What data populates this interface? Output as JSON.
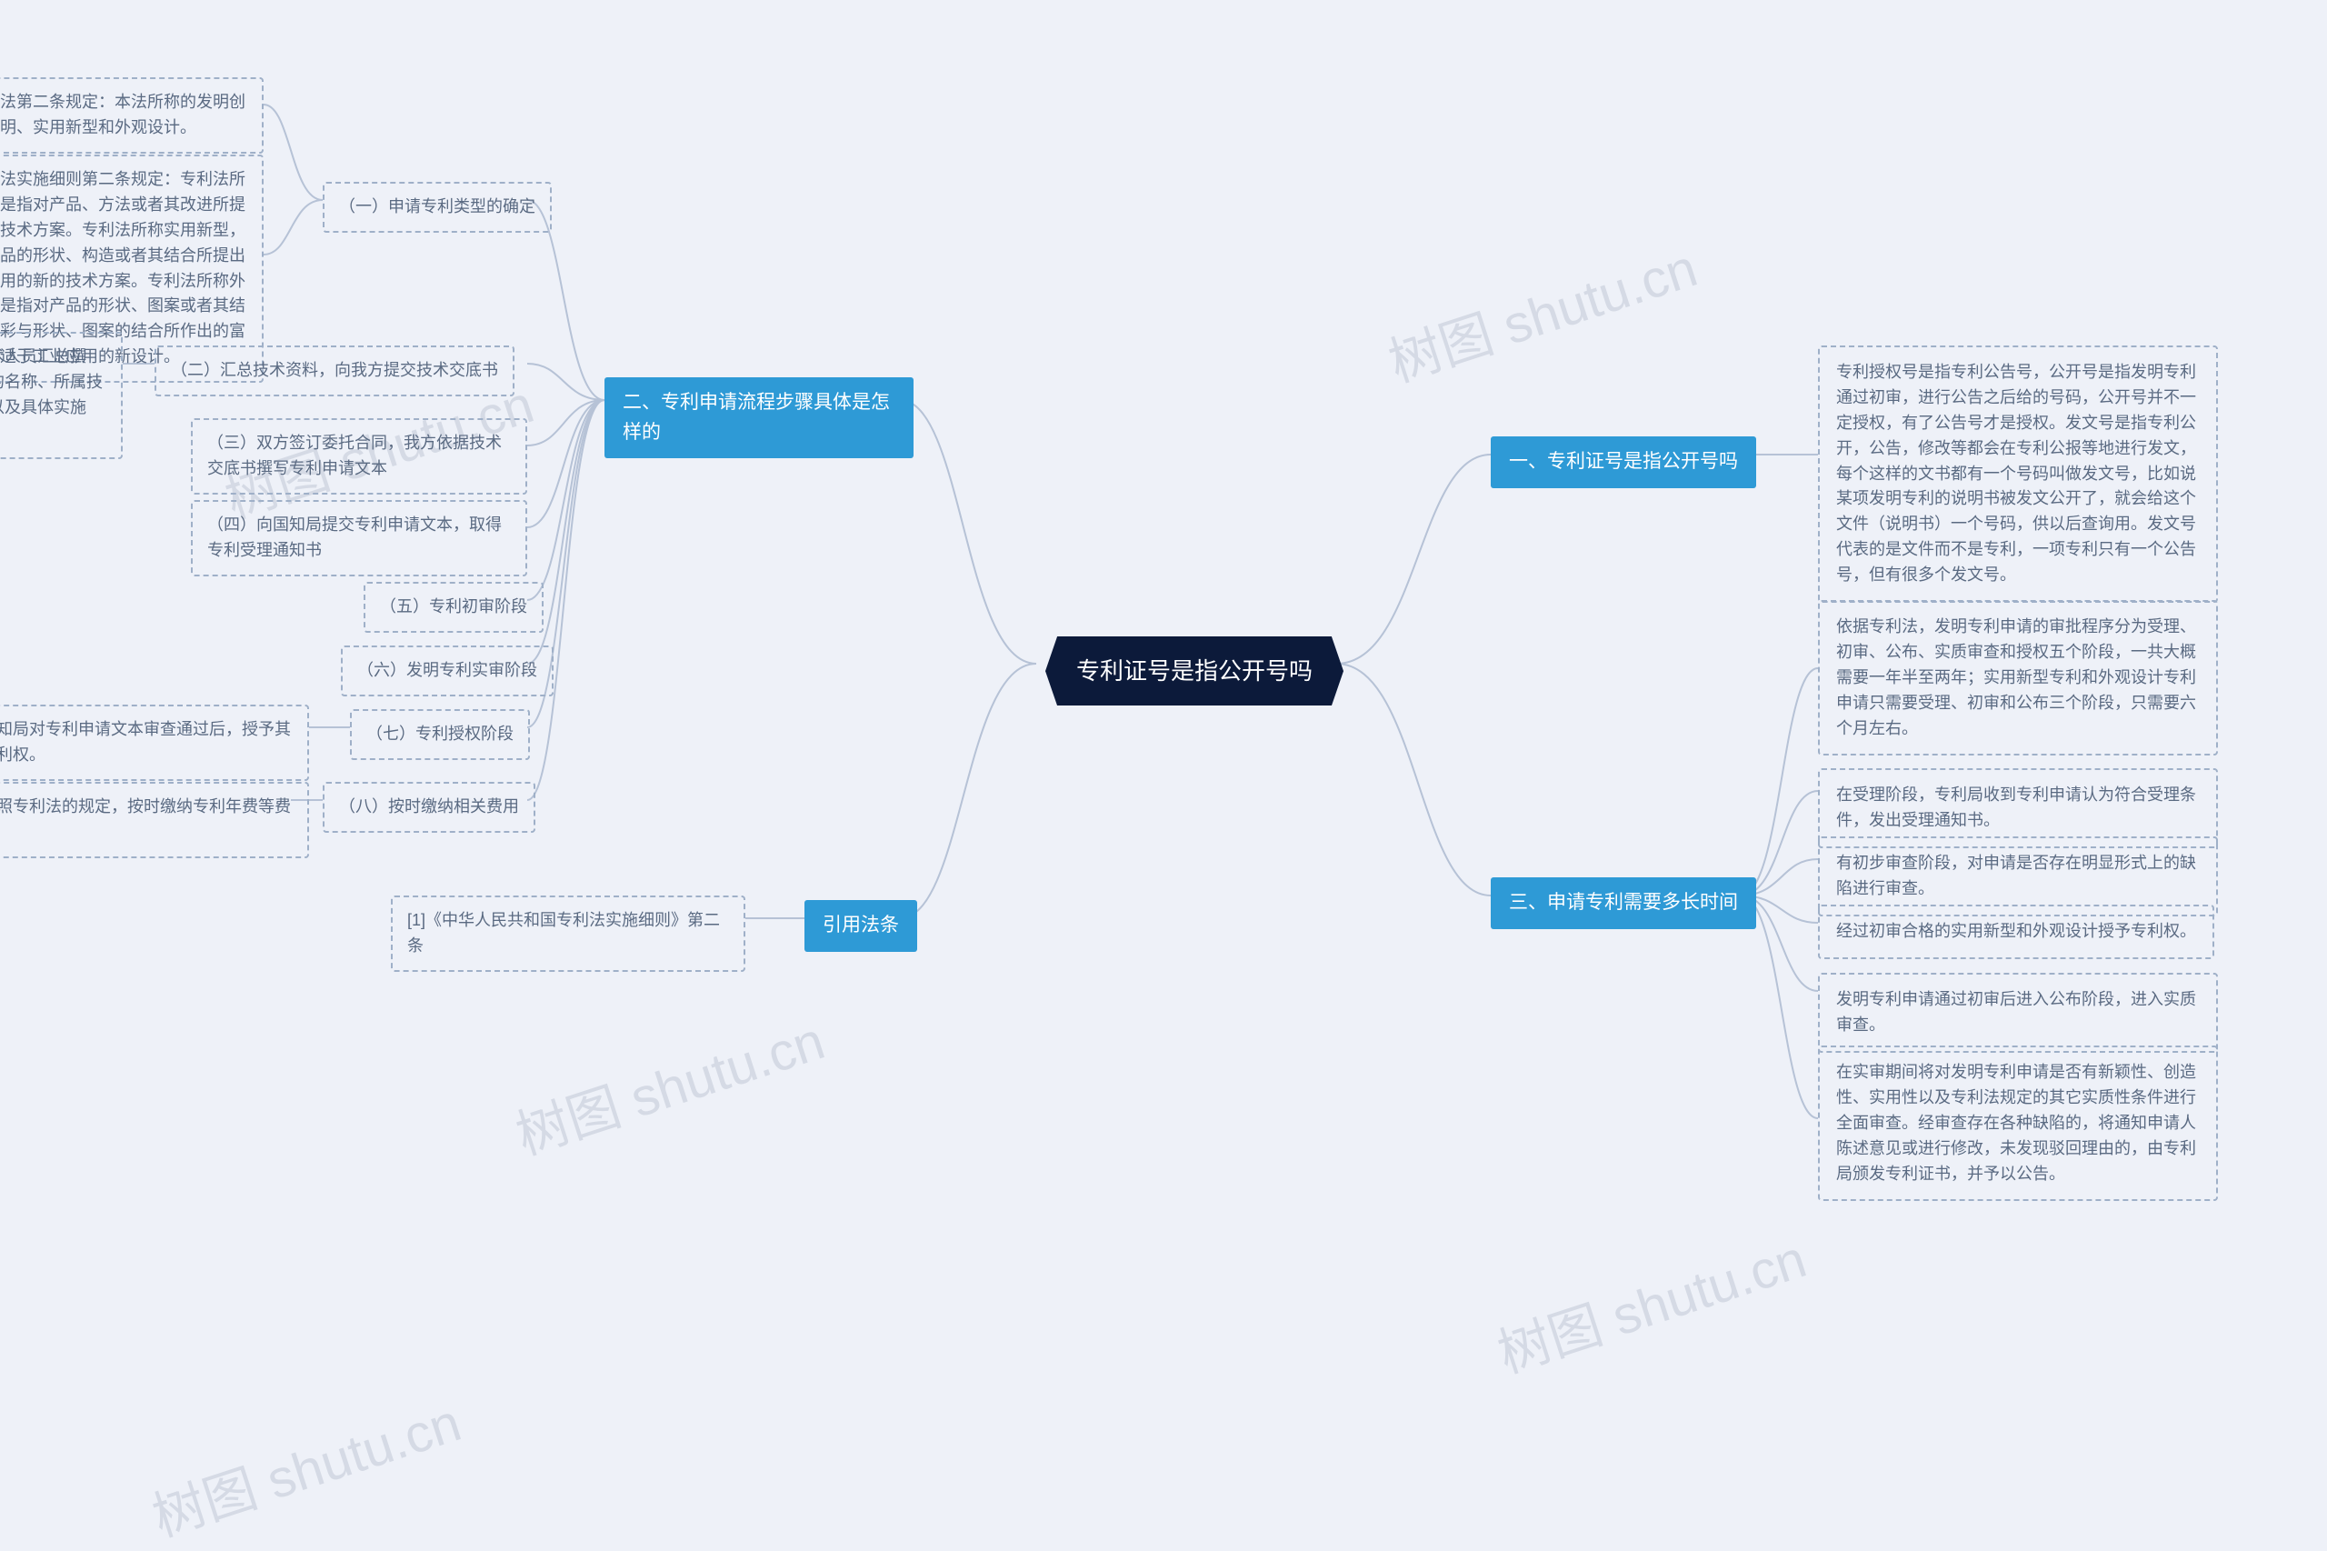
{
  "watermark": "树图 shutu.cn",
  "center": "专利证号是指公开号吗",
  "right": {
    "b1": {
      "label": "一、专利证号是指公开号吗",
      "leaf": "专利授权号是指专利公告号，公开号是指发明专利通过初审，进行公告之后给的号码，公开号并不一定授权，有了公告号才是授权。发文号是指专利公开，公告，修改等都会在专利公报等地进行发文，每个这样的文书都有一个号码叫做发文号，比如说某项发明专利的说明书被发文公开了，就会给这个文件（说明书）一个号码，供以后查询用。发文号代表的是文件而不是专利，一项专利只有一个公告号，但有很多个发文号。"
    },
    "b3": {
      "label": "三、申请专利需要多长时间",
      "l1": "依据专利法，发明专利申请的审批程序分为受理、初审、公布、实质审查和授权五个阶段，一共大概需要一年半至两年；实用新型专利和外观设计专利申请只需要受理、初审和公布三个阶段，只需要六个月左右。",
      "l2": "在受理阶段，专利局收到专利申请认为符合受理条件，发出受理通知书。",
      "l3": "有初步审查阶段，对申请是否存在明显形式上的缺陷进行审查。",
      "l4": "经过初审合格的实用新型和外观设计授予专利权。",
      "l5": "发明专利申请通过初审后进入公布阶段，进入实质审查。",
      "l6": "在实审期间将对发明专利申请是否有新颖性、创造性、实用性以及专利法规定的其它实质性条件进行全面审查。经审查存在各种缺陷的，将通知申请人陈述意见或进行修改，未发现驳回理由的，由专利局颁发专利证书，并予以公告。"
    }
  },
  "left": {
    "b2": {
      "label": "二、专利申请流程步骤具体是怎样的",
      "s1": {
        "label": "（一）申请专利类型的确定",
        "d1": "我国专利法第二条规定：本法所称的发明创造是指发明、实用新型和外观设计。",
        "d2": "我国专利法实施细则第二条规定：专利法所称发明，是指对产品、方法或者其改进所提出的新的技术方案。专利法所称实用新型，是指对产品的形状、构造或者其结合所提出的适于实用的新的技术方案。专利法所称外观设计，是指对产品的形状、图案或者其结合以及色彩与形状、图案的结合所作出的富有美感并适于工业应用的新设计。"
      },
      "s2": {
        "label": "（二）汇总技术资料，向我方提交技术交底书",
        "d1": "技术交底书一般由客户方的技术人员汇总撰写，技术交底书包括发明创造的名称、所属技术领域、背景技术、发明内容以及具体实施例。"
      },
      "s3": "（三）双方签订委托合同，我方依据技术交底书撰写专利申请文本",
      "s4": "（四）向国知局提交专利申请文本，取得专利受理通知书",
      "s5": "（五）专利初审阶段",
      "s6": "（六）发明专利实审阶段",
      "s7": {
        "label": "（七）专利授权阶段",
        "d1": "国知局对专利申请文本审查通过后，授予其专利权。"
      },
      "s8": {
        "label": "（八）按时缴纳相关费用",
        "d1": "按照专利法的规定，按时缴纳专利年费等费用"
      },
      "cite": {
        "label": "引用法条",
        "d1": "[1]《中华人民共和国专利法实施细则》第二条"
      }
    }
  }
}
